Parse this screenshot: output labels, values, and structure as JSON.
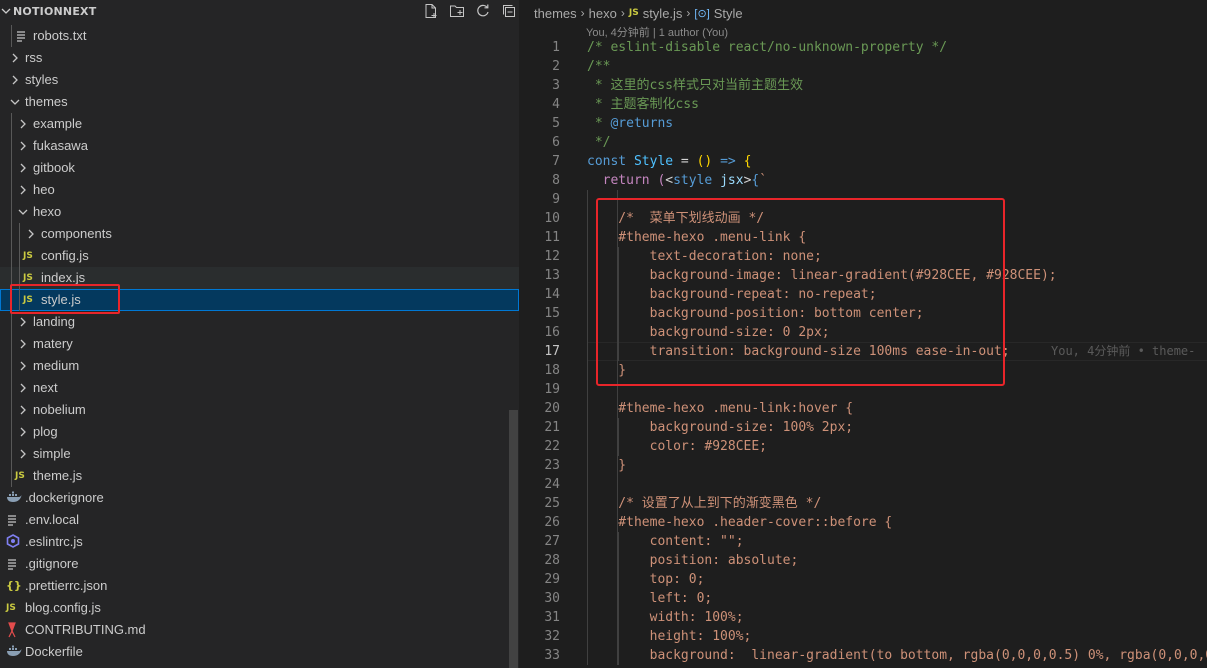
{
  "explorer": {
    "title": "NOTIONNEXT",
    "actions": [
      "new-file-icon",
      "new-folder-icon",
      "refresh-icon",
      "collapse-all-icon"
    ],
    "items": [
      {
        "label": "robots.txt",
        "type": "file",
        "icon": "lines",
        "depth": 1
      },
      {
        "label": "rss",
        "type": "folder",
        "open": false,
        "depth": 0
      },
      {
        "label": "styles",
        "type": "folder",
        "open": false,
        "depth": 0
      },
      {
        "label": "themes",
        "type": "folder",
        "open": true,
        "depth": 0
      },
      {
        "label": "example",
        "type": "folder",
        "open": false,
        "depth": 1
      },
      {
        "label": "fukasawa",
        "type": "folder",
        "open": false,
        "depth": 1
      },
      {
        "label": "gitbook",
        "type": "folder",
        "open": false,
        "depth": 1
      },
      {
        "label": "heo",
        "type": "folder",
        "open": false,
        "depth": 1
      },
      {
        "label": "hexo",
        "type": "folder",
        "open": true,
        "depth": 1
      },
      {
        "label": "components",
        "type": "folder",
        "open": false,
        "depth": 2
      },
      {
        "label": "config.js",
        "type": "file",
        "icon": "js",
        "depth": 2
      },
      {
        "label": "index.js",
        "type": "file",
        "icon": "js",
        "depth": 2,
        "hovered": true
      },
      {
        "label": "style.js",
        "type": "file",
        "icon": "js",
        "depth": 2,
        "selected": true
      },
      {
        "label": "landing",
        "type": "folder",
        "open": false,
        "depth": 1
      },
      {
        "label": "matery",
        "type": "folder",
        "open": false,
        "depth": 1
      },
      {
        "label": "medium",
        "type": "folder",
        "open": false,
        "depth": 1
      },
      {
        "label": "next",
        "type": "folder",
        "open": false,
        "depth": 1
      },
      {
        "label": "nobelium",
        "type": "folder",
        "open": false,
        "depth": 1
      },
      {
        "label": "plog",
        "type": "folder",
        "open": false,
        "depth": 1
      },
      {
        "label": "simple",
        "type": "folder",
        "open": false,
        "depth": 1
      },
      {
        "label": "theme.js",
        "type": "file",
        "icon": "js",
        "depth": 1
      },
      {
        "label": ".dockerignore",
        "type": "file",
        "icon": "docker",
        "depth": 0
      },
      {
        "label": ".env.local",
        "type": "file",
        "icon": "lines",
        "depth": 0
      },
      {
        "label": ".eslintrc.js",
        "type": "file",
        "icon": "eslint",
        "depth": 0
      },
      {
        "label": ".gitignore",
        "type": "file",
        "icon": "lines",
        "depth": 0
      },
      {
        "label": ".prettierrc.json",
        "type": "file",
        "icon": "json",
        "depth": 0
      },
      {
        "label": "blog.config.js",
        "type": "file",
        "icon": "js",
        "depth": 0
      },
      {
        "label": "CONTRIBUTING.md",
        "type": "file",
        "icon": "md",
        "depth": 0
      },
      {
        "label": "Dockerfile",
        "type": "file",
        "icon": "docker",
        "depth": 0
      }
    ]
  },
  "editor": {
    "breadcrumb": [
      "themes",
      "hexo",
      "style.js",
      "Style"
    ],
    "file_icon": "JS",
    "blame_header": "You, 4分钟前 | 1 author (You)",
    "active_line": 17,
    "inline_blame": "You, 4分钟前 • theme-",
    "lines": [
      {
        "n": "1",
        "tokens": [
          [
            "c-com",
            "/* eslint-disable react/no-unknown-property */"
          ]
        ]
      },
      {
        "n": "2",
        "tokens": [
          [
            "c-com",
            "/**"
          ]
        ]
      },
      {
        "n": "3",
        "tokens": [
          [
            "c-com",
            " * 这里的css样式只对当前主题生效"
          ]
        ]
      },
      {
        "n": "4",
        "tokens": [
          [
            "c-com",
            " * 主题客制化css"
          ]
        ]
      },
      {
        "n": "5",
        "tokens": [
          [
            "c-com",
            " * "
          ],
          [
            "c-ann",
            "@returns"
          ]
        ]
      },
      {
        "n": "6",
        "tokens": [
          [
            "c-com",
            " */"
          ]
        ]
      },
      {
        "n": "7",
        "tokens": [
          [
            "c-kw",
            "const "
          ],
          [
            "c-var",
            "Style"
          ],
          [
            "c-pun",
            " = "
          ],
          [
            "c-yel",
            "()"
          ],
          [
            "c-pun",
            " "
          ],
          [
            "c-kw",
            "=>"
          ],
          [
            "c-pun",
            " "
          ],
          [
            "c-yel",
            "{"
          ]
        ]
      },
      {
        "n": "8",
        "tokens": [
          [
            "c-pun",
            "  "
          ],
          [
            "c-ctl",
            "return"
          ],
          [
            "c-pun",
            " "
          ],
          [
            "c-ctl",
            "("
          ],
          [
            "c-pun",
            "<"
          ],
          [
            "c-kw",
            "style"
          ],
          [
            "c-pun",
            " "
          ],
          [
            "c-attr",
            "jsx"
          ],
          [
            "c-pun",
            ">"
          ],
          [
            "c-kw",
            "{"
          ],
          [
            "c-str",
            "`"
          ]
        ]
      },
      {
        "n": "9",
        "tokens": [
          [
            "c-str",
            ""
          ]
        ]
      },
      {
        "n": "10",
        "tokens": [
          [
            "c-str",
            "    /*  菜单下划线动画 */"
          ]
        ]
      },
      {
        "n": "11",
        "tokens": [
          [
            "c-str",
            "    #theme-hexo .menu-link {"
          ]
        ]
      },
      {
        "n": "12",
        "tokens": [
          [
            "c-str",
            "        text-decoration: none;"
          ]
        ]
      },
      {
        "n": "13",
        "tokens": [
          [
            "c-str",
            "        background-image: linear-gradient(#928CEE, #928CEE);"
          ]
        ]
      },
      {
        "n": "14",
        "tokens": [
          [
            "c-str",
            "        background-repeat: no-repeat;"
          ]
        ]
      },
      {
        "n": "15",
        "tokens": [
          [
            "c-str",
            "        background-position: bottom center;"
          ]
        ]
      },
      {
        "n": "16",
        "tokens": [
          [
            "c-str",
            "        background-size: 0 2px;"
          ]
        ]
      },
      {
        "n": "17",
        "tokens": [
          [
            "c-str",
            "        transition: background-size 100ms ease-in-out;"
          ]
        ]
      },
      {
        "n": "18",
        "tokens": [
          [
            "c-str",
            "    }"
          ]
        ]
      },
      {
        "n": "19",
        "tokens": [
          [
            "c-str",
            ""
          ]
        ]
      },
      {
        "n": "20",
        "tokens": [
          [
            "c-str",
            "    #theme-hexo .menu-link:hover {"
          ]
        ]
      },
      {
        "n": "21",
        "tokens": [
          [
            "c-str",
            "        background-size: 100% 2px;"
          ]
        ]
      },
      {
        "n": "22",
        "tokens": [
          [
            "c-str",
            "        color: #928CEE;"
          ]
        ]
      },
      {
        "n": "23",
        "tokens": [
          [
            "c-str",
            "    }"
          ]
        ]
      },
      {
        "n": "24",
        "tokens": [
          [
            "c-str",
            ""
          ]
        ]
      },
      {
        "n": "25",
        "tokens": [
          [
            "c-str",
            "    /* 设置了从上到下的渐变黑色 */"
          ]
        ]
      },
      {
        "n": "26",
        "tokens": [
          [
            "c-str",
            "    #theme-hexo .header-cover::before {"
          ]
        ]
      },
      {
        "n": "27",
        "tokens": [
          [
            "c-str",
            "        content: \"\";"
          ]
        ]
      },
      {
        "n": "28",
        "tokens": [
          [
            "c-str",
            "        position: absolute;"
          ]
        ]
      },
      {
        "n": "29",
        "tokens": [
          [
            "c-str",
            "        top: 0;"
          ]
        ]
      },
      {
        "n": "30",
        "tokens": [
          [
            "c-str",
            "        left: 0;"
          ]
        ]
      },
      {
        "n": "31",
        "tokens": [
          [
            "c-str",
            "        width: 100%;"
          ]
        ]
      },
      {
        "n": "32",
        "tokens": [
          [
            "c-str",
            "        height: 100%;"
          ]
        ]
      },
      {
        "n": "33",
        "tokens": [
          [
            "c-str",
            "        background:  linear-gradient(to bottom, rgba(0,0,0,0.5) 0%, rgba(0,0,0,0."
          ]
        ]
      }
    ]
  },
  "colors": {
    "sidebar_bg": "#252526",
    "editor_bg": "#1e1e1e",
    "selection": "#04395e",
    "highlight_red": "#e8252a",
    "js_yellow": "#cbcb41"
  }
}
